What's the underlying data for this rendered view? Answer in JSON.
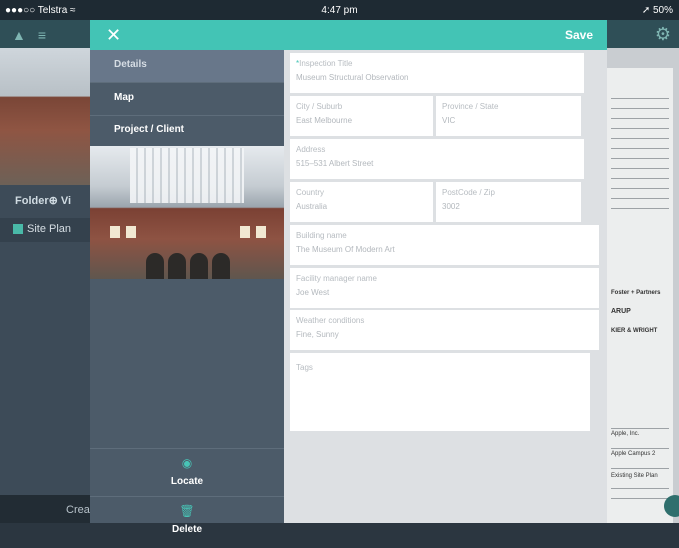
{
  "status_bar": {
    "carrier": "●●●○○ Telstra ≈",
    "time": "4:47 pm",
    "battery": "➚ 50%"
  },
  "background": {
    "folder_label": "Folder⊕   Vi",
    "site_plan_label": "Site Plan",
    "create_label": "Crea"
  },
  "modal": {
    "save_label": "Save",
    "sidebar": {
      "items": [
        {
          "label": "Details"
        },
        {
          "label": "Map"
        },
        {
          "label": "Project / Client"
        }
      ],
      "locate_label": "Locate",
      "delete_label": "Delete"
    },
    "form": {
      "inspection_title": {
        "required_mark": "*",
        "label": "Inspection Title",
        "value": "Museum Structural Observation"
      },
      "city": {
        "label": "City / Suburb",
        "value": "East Melbourne"
      },
      "province": {
        "label": "Province / State",
        "value": "VIC"
      },
      "address": {
        "label": "Address",
        "value": "515–531 Albert Street"
      },
      "country": {
        "label": "Country",
        "value": "Australia"
      },
      "postcode": {
        "label": "PostCode / Zip",
        "value": "3002"
      },
      "building_name": {
        "label": "Building name",
        "value": "The Museum Of Modern Art"
      },
      "facility_manager": {
        "label": "Facility manager name",
        "value": "Joe West"
      },
      "weather": {
        "label": "Weather conditions",
        "value": "Fine, Sunny"
      },
      "tags": {
        "label": "Tags",
        "value": ""
      }
    }
  },
  "drawing_text": [
    "Foster + Partners",
    "ARUP",
    "KIER & WRIGHT",
    "Apple, Inc.",
    "Apple Campus 2",
    "Existing Site Plan"
  ],
  "colors": {
    "accent": "#43c4b5",
    "sidebar": "#4c5b69",
    "sidebar_active": "#68778a",
    "form_bg": "#dde0e3"
  },
  "icons": {
    "close": "cross-icon",
    "locate": "location-pin-icon",
    "delete": "trash-icon",
    "edit": "pencil-icon"
  }
}
